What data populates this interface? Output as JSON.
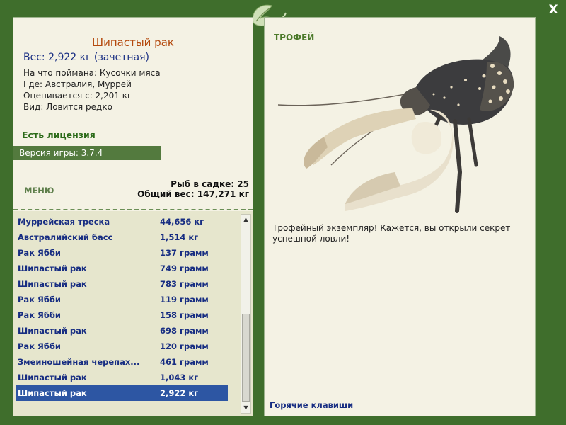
{
  "close_label": "X",
  "fish": {
    "title": "Шипастый рак",
    "weight_line": "Вес: 2,922 кг (зачетная)",
    "bait_line": "На что поймана: Кусочки мяса",
    "where_line": "Где: Австралия, Муррей",
    "value_line": "Оценивается с: 2,201 кг",
    "kind_line": "Вид: Ловится редко"
  },
  "license": "Есть лицензия",
  "version": "Версия игры: 3.7.4",
  "menu_label": "МЕНЮ",
  "stats": {
    "count": "Рыб в садке: 25",
    "total": "Общий вес: 147,271 кг"
  },
  "catch_list": [
    {
      "name": "Муррейская треска",
      "weight": "44,656 кг"
    },
    {
      "name": "Австралийский басс",
      "weight": "1,514 кг"
    },
    {
      "name": "Рак Ябби",
      "weight": "137 грамм"
    },
    {
      "name": "Шипастый рак",
      "weight": "749 грамм"
    },
    {
      "name": "Шипастый рак",
      "weight": "783 грамм"
    },
    {
      "name": "Рак Ябби",
      "weight": "119 грамм"
    },
    {
      "name": "Рак Ябби",
      "weight": "158 грамм"
    },
    {
      "name": "Шипастый рак",
      "weight": "698 грамм"
    },
    {
      "name": "Рак Ябби",
      "weight": "120 грамм"
    },
    {
      "name": "Змеиношейная черепах...",
      "weight": "461 грамм"
    },
    {
      "name": "Шипастый рак",
      "weight": "1,043 кг"
    },
    {
      "name": "Шипастый рак",
      "weight": "2,922 кг"
    }
  ],
  "trophy": {
    "label": "ТРОФЕЙ",
    "text": "Трофейный экземпляр! Кажется, вы открыли секрет успешной ловли!"
  },
  "hotkeys": "Горячие клавиши",
  "colors": {
    "frame": "#3f6e2c",
    "panel": "#f4f2e4",
    "list_bg": "#e6e6cd",
    "title": "#b4490d",
    "link_blue": "#172d82",
    "selected": "#2d56a3",
    "green_label": "#4c7a2a"
  },
  "icons": [
    "close-icon",
    "leaf-logo-icon",
    "crayfish-image",
    "scroll-up-arrow-icon",
    "scroll-down-arrow-icon"
  ]
}
